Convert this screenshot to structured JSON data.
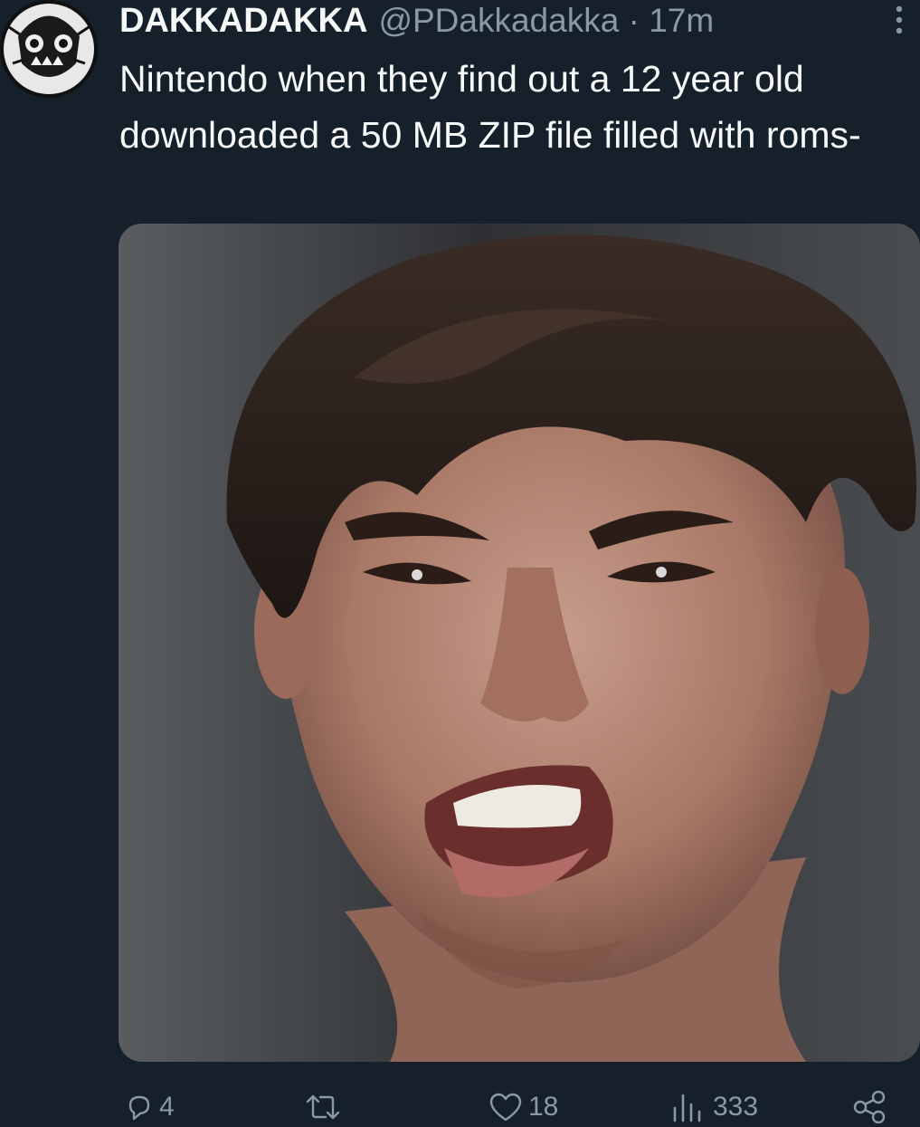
{
  "tweet": {
    "display_name": "DAKKADAKKA",
    "handle": "@PDakkadakka",
    "separator": "·",
    "time": "17m",
    "text": "Nintendo when they find out a 12 year old downloaded a 50 MB ZIP file filled with roms-",
    "avatar_icon": "ork-skull-avatar",
    "media_description_icon": "crying-grimacing-face-photo"
  },
  "actions": {
    "reply": {
      "icon": "reply-icon",
      "count": "4"
    },
    "retweet": {
      "icon": "retweet-icon",
      "count": ""
    },
    "like": {
      "icon": "heart-icon",
      "count": "18"
    },
    "views": {
      "icon": "views-icon",
      "count": "333"
    },
    "share": {
      "icon": "share-icon"
    }
  },
  "colors": {
    "background": "#15202b",
    "primary_text": "#f7f9f9",
    "secondary_text": "#8b98a5"
  }
}
